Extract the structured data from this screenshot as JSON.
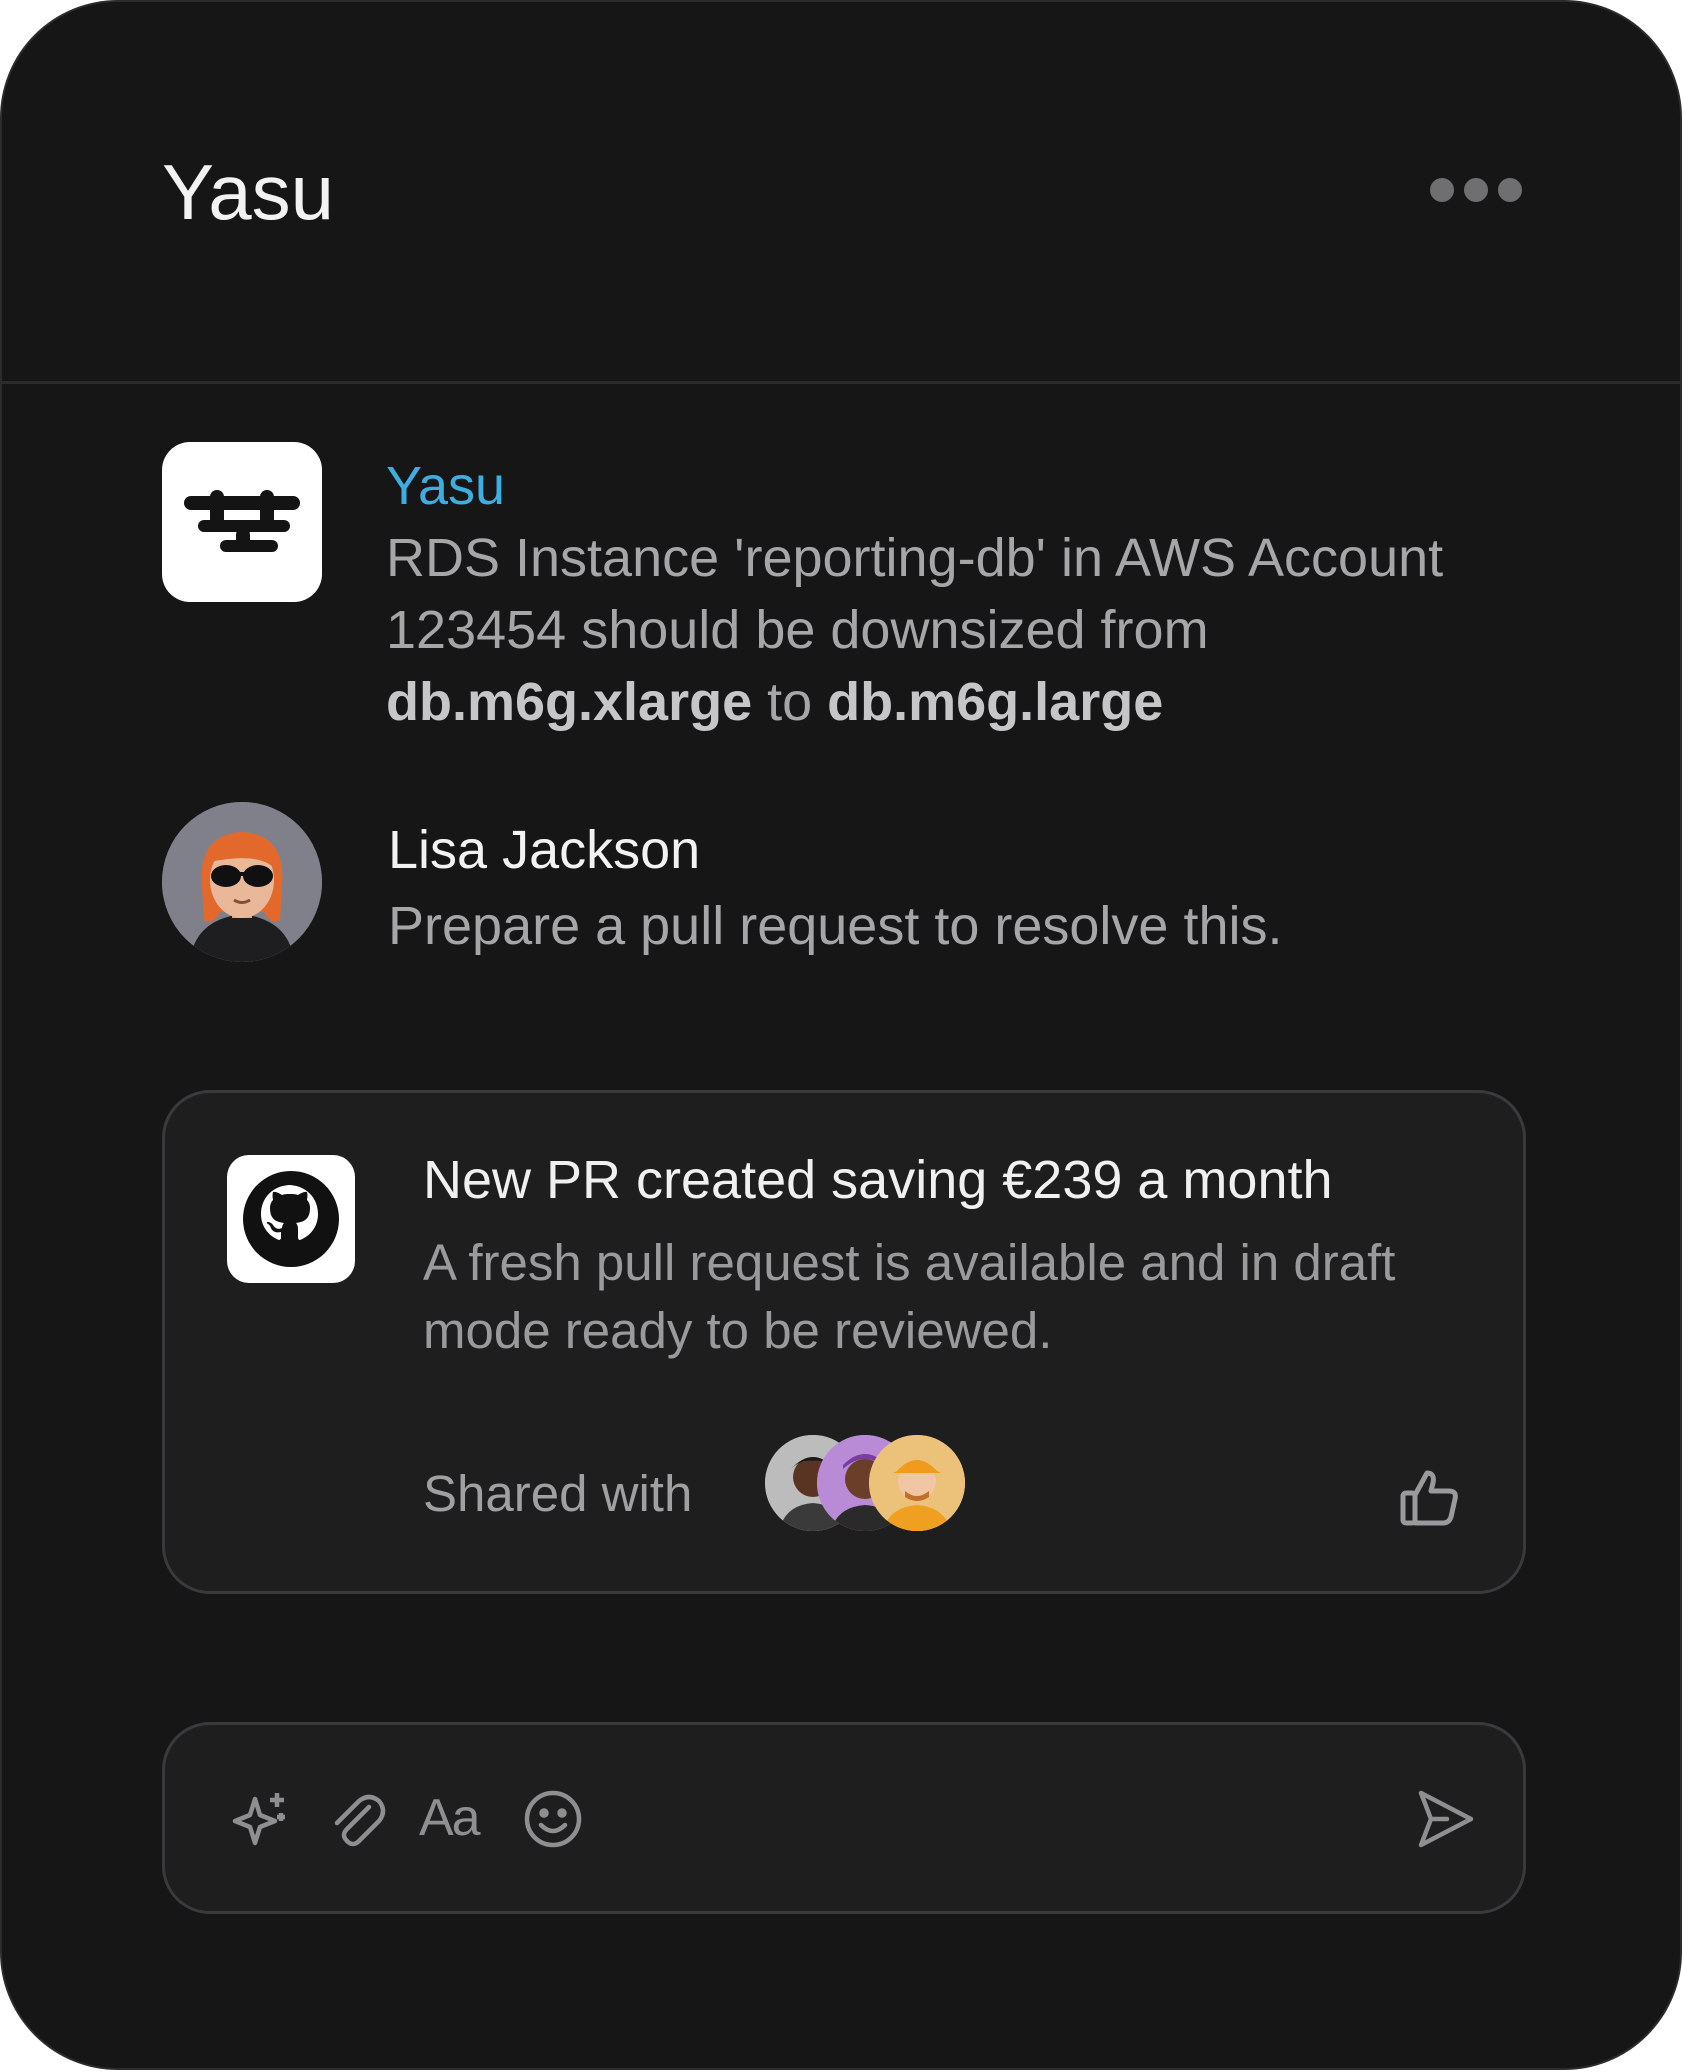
{
  "header": {
    "title": "Yasu",
    "more_icon": "more-horizontal-icon"
  },
  "messages": [
    {
      "author": "Yasu",
      "author_color": "#3eaee0",
      "avatar_icon": "yasu-logo-icon",
      "text_parts": {
        "line1": "RDS Instance 'reporting-db' in AWS Account",
        "line2": "123454 should be downsized from",
        "from_size": "db.m6g.xlarge",
        "connector": " to ",
        "to_size": "db.m6g.large"
      }
    },
    {
      "author": "Lisa Jackson",
      "author_color": "#f2f2f2",
      "avatar_icon": "user-avatar",
      "text": "Prepare a pull request to resolve this."
    }
  ],
  "pr_card": {
    "icon": "github-icon",
    "title": "New PR created saving €239 a month",
    "description": "A fresh pull request is available and in draft mode ready to be reviewed.",
    "shared_label": "Shared with",
    "shared_with_avatars": [
      "user-avatar",
      "user-avatar",
      "user-avatar"
    ],
    "like_icon": "thumbs-up-icon"
  },
  "composer": {
    "tools": [
      "sparkles-icon",
      "paperclip-icon",
      "text-format-icon",
      "emoji-icon"
    ],
    "format_label": "Aa",
    "send_icon": "send-icon"
  },
  "colors": {
    "background": "#161617",
    "card": "#1e1e1f",
    "accent": "#3eaee0",
    "muted_text": "#a6a6a8"
  }
}
